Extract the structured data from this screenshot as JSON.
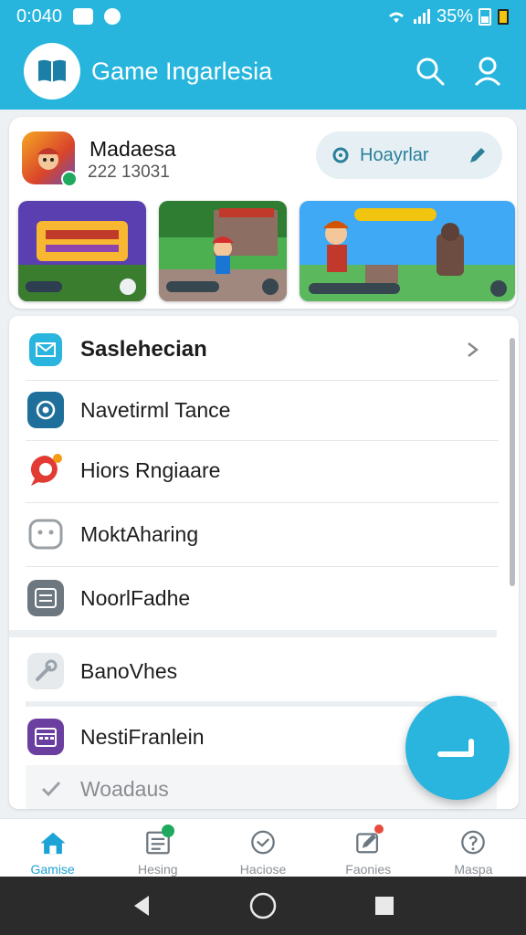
{
  "status_bar": {
    "time": "0:040",
    "battery": "35%"
  },
  "app_bar": {
    "title": "Game Ingarlesia"
  },
  "profile": {
    "name": "Madaesa",
    "id": "222 13031",
    "pill_label": "Hoayrlar"
  },
  "list": {
    "header": "Saslehecian",
    "items": [
      {
        "label": "Navetirml Tance",
        "icon": "camera-icon",
        "color": "#1f6f9b"
      },
      {
        "label": "Hiors Rngiaare",
        "icon": "chat-bubble-icon",
        "color": "#e13b34"
      },
      {
        "label": "MoktAharing",
        "icon": "robot-face-icon",
        "color": "#9aa0a6"
      },
      {
        "label": "NoorlFadhe",
        "icon": "document-icon",
        "color": "#6d7780"
      }
    ],
    "second_items": [
      {
        "label": "BanoVhes",
        "icon": "wrench-icon",
        "color": "#b9c2c9"
      },
      {
        "label": "NestiFranlein",
        "icon": "calendar-icon",
        "color": "#6b3fa0"
      },
      {
        "label": "Woadaus",
        "icon": "check-icon",
        "color": "#9aa0a6"
      }
    ]
  },
  "bottom_nav": [
    {
      "label": "Gamise",
      "icon": "home-icon",
      "active": true
    },
    {
      "label": "Hesing",
      "icon": "list-icon",
      "active": false
    },
    {
      "label": "Haciose",
      "icon": "clock-icon",
      "active": false
    },
    {
      "label": "Faonies",
      "icon": "edit-icon",
      "active": false
    },
    {
      "label": "Maspa",
      "icon": "info-icon",
      "active": false
    }
  ],
  "colors": {
    "primary": "#27b5dd",
    "fab": "#29b5de",
    "active_nav": "#1ea3d6",
    "system_nav": "#2b2b2b"
  }
}
